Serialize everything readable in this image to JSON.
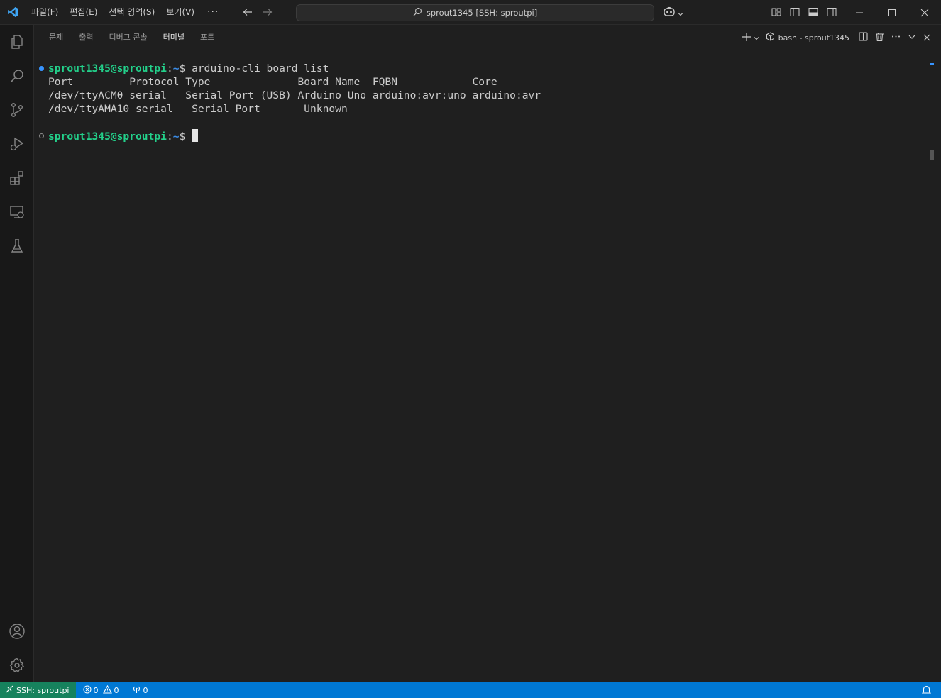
{
  "titlebar": {
    "menu": [
      "파일(F)",
      "편집(E)",
      "선택 영역(S)",
      "보기(V)"
    ],
    "more": "···",
    "search_text": "sprout1345 [SSH: sproutpi]"
  },
  "activitybar": {
    "items": [
      "files-icon",
      "search-icon",
      "source-control-icon",
      "run-debug-icon",
      "extensions-icon",
      "remote-explorer-icon",
      "testing-icon"
    ],
    "bottom": [
      "account-icon",
      "settings-gear-icon"
    ]
  },
  "panel": {
    "tabs": [
      "문제",
      "출력",
      "디버그 콘솔",
      "터미널",
      "포트"
    ],
    "active_tab": "터미널",
    "terminal_name": "bash - sprout1345"
  },
  "terminal": {
    "prompt_user": "sprout1345@sproutpi",
    "prompt_sep": ":",
    "prompt_path": "~",
    "prompt_symbol": "$ ",
    "command": "arduino-cli board list",
    "output": [
      "Port         Protocol Type              Board Name  FQBN            Core",
      "/dev/ttyACM0 serial   Serial Port (USB) Arduino Uno arduino:avr:uno arduino:avr",
      "/dev/ttyAMA10 serial   Serial Port       Unknown"
    ]
  },
  "statusbar": {
    "remote": "SSH: sproutpi",
    "errors": "0",
    "warnings": "0",
    "ports": "0"
  }
}
